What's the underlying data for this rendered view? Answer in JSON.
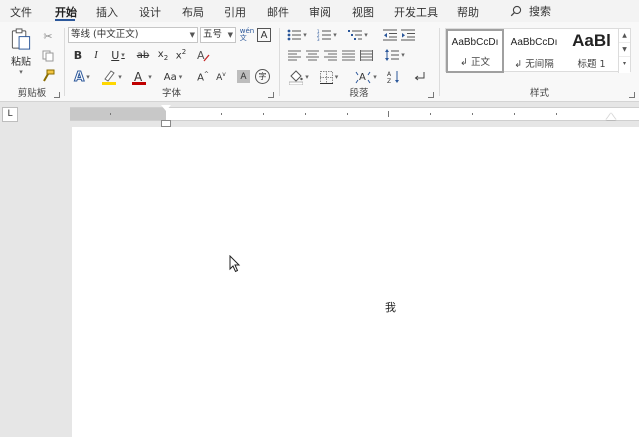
{
  "tabs": [
    "文件",
    "开始",
    "插入",
    "设计",
    "布局",
    "引用",
    "邮件",
    "审阅",
    "视图",
    "开发工具",
    "帮助"
  ],
  "active_tab": "开始",
  "search_label": "搜索",
  "clipboard": {
    "paste_label": "粘贴",
    "group_label": "剪贴板"
  },
  "font": {
    "name": "等线 (中文正文)",
    "size": "五号",
    "group_label": "字体"
  },
  "paragraph": {
    "group_label": "段落"
  },
  "styles": {
    "group_label": "样式",
    "items": [
      {
        "preview": "AaBbCcDı",
        "name": "↲ 正文"
      },
      {
        "preview": "AaBbCcDı",
        "name": "↲ 无间隔"
      },
      {
        "preview": "AaBl",
        "name": "标题 1"
      }
    ]
  },
  "ruler_corner": "L",
  "document": {
    "text": "我"
  },
  "colors": {
    "accent": "#2b579a",
    "highlight": "#ffd700",
    "font_color": "#c00000"
  }
}
